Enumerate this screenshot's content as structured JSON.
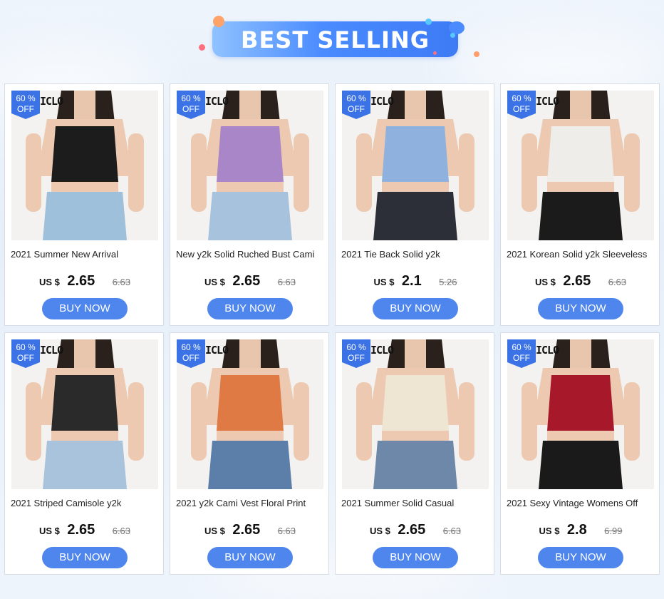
{
  "banner": {
    "title": "BEST SELLING"
  },
  "badge": {
    "line1": "60 %",
    "line2": "OFF"
  },
  "brand": "ICLO",
  "currency": "US $",
  "buy_label": "BUY NOW",
  "products": [
    {
      "title": "2021 Summer New Arrival",
      "price": "2.65",
      "old_price": "6.63",
      "top_color": "#1c1c1c",
      "bottom_color": "#9fc0da"
    },
    {
      "title": "New y2k Solid Ruched Bust Cami",
      "price": "2.65",
      "old_price": "6.63",
      "top_color": "#a886c8",
      "bottom_color": "#a7c2dc"
    },
    {
      "title": "2021 Tie Back Solid y2k",
      "price": "2.1",
      "old_price": "5.26",
      "top_color": "#8fb1de",
      "bottom_color": "#2c2f38"
    },
    {
      "title": "2021 Korean Solid y2k Sleeveless",
      "price": "2.65",
      "old_price": "6.63",
      "top_color": "#efedea",
      "bottom_color": "#1b1b1b"
    },
    {
      "title": "2021 Striped Camisole y2k",
      "price": "2.65",
      "old_price": "6.63",
      "top_color": "#2a2a2a",
      "bottom_color": "#a9c3dd"
    },
    {
      "title": "2021 y2k Cami Vest Floral Print",
      "price": "2.65",
      "old_price": "6.63",
      "top_color": "#e07a45",
      "bottom_color": "#5b7fa8"
    },
    {
      "title": "2021 Summer Solid Casual",
      "price": "2.65",
      "old_price": "6.63",
      "top_color": "#eee6d2",
      "bottom_color": "#6d88a8"
    },
    {
      "title": "2021 Sexy Vintage Womens Off",
      "price": "2.8",
      "old_price": "6.99",
      "top_color": "#a8182b",
      "bottom_color": "#1a1a1a"
    }
  ]
}
